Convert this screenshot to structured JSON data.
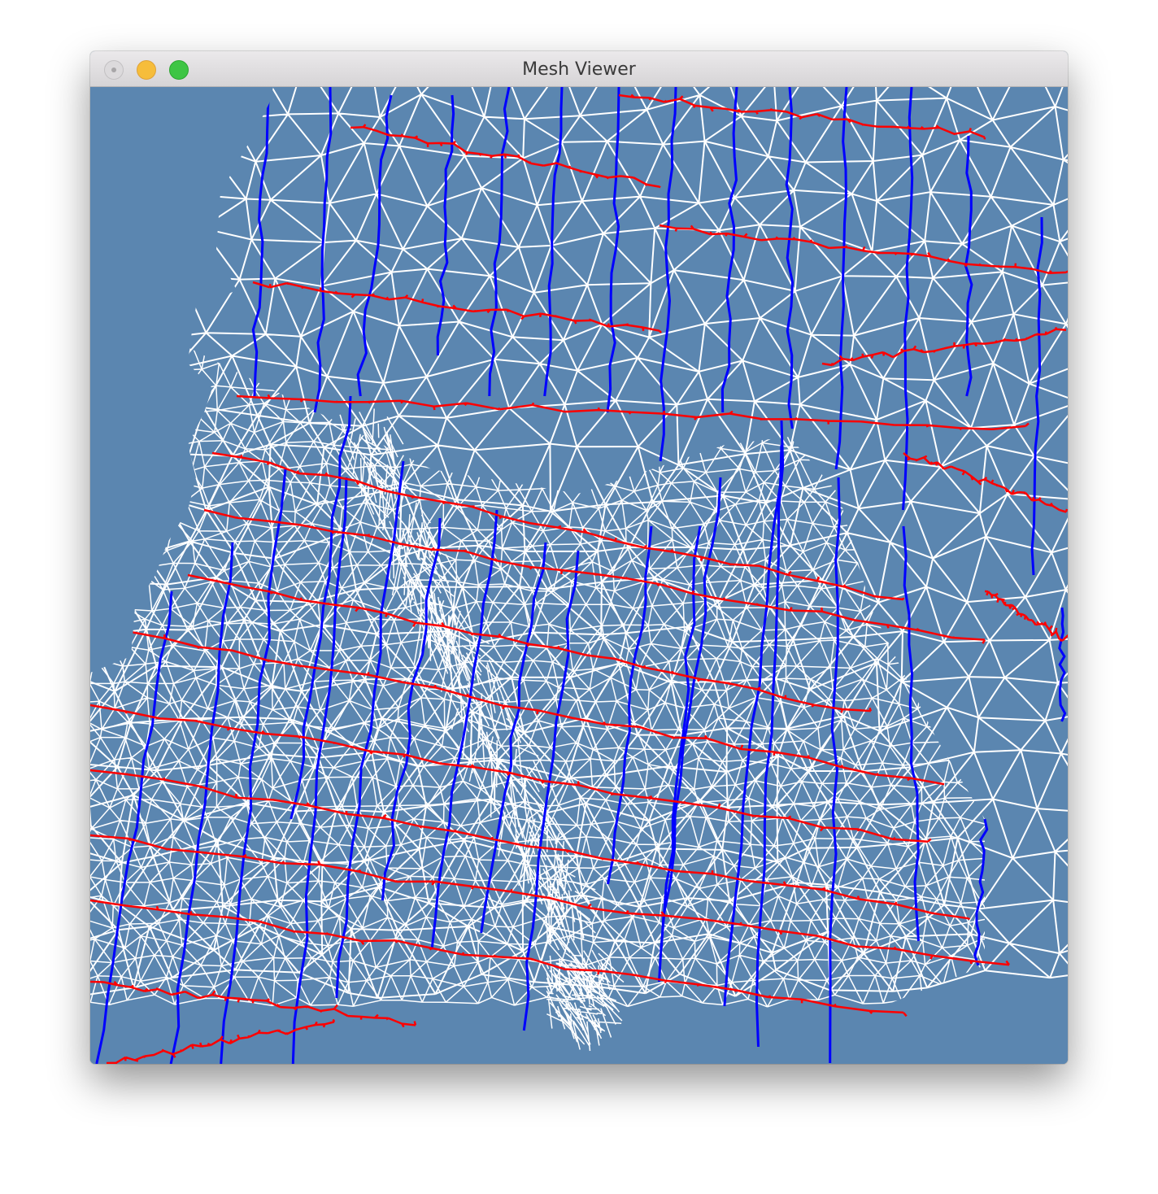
{
  "window": {
    "title": "Mesh Viewer"
  },
  "titlebar_buttons": [
    {
      "name": "close",
      "color": "#dcdadc"
    },
    {
      "name": "minimize",
      "color": "#f6bd3b"
    },
    {
      "name": "zoom",
      "color": "#3ec544"
    }
  ],
  "viewport": {
    "background_color": "#5b86b0",
    "edge_colors": {
      "mesh": "#ffffff",
      "vertical_seams": "#0000ff",
      "horizontal_seams": "#ff0000"
    }
  }
}
